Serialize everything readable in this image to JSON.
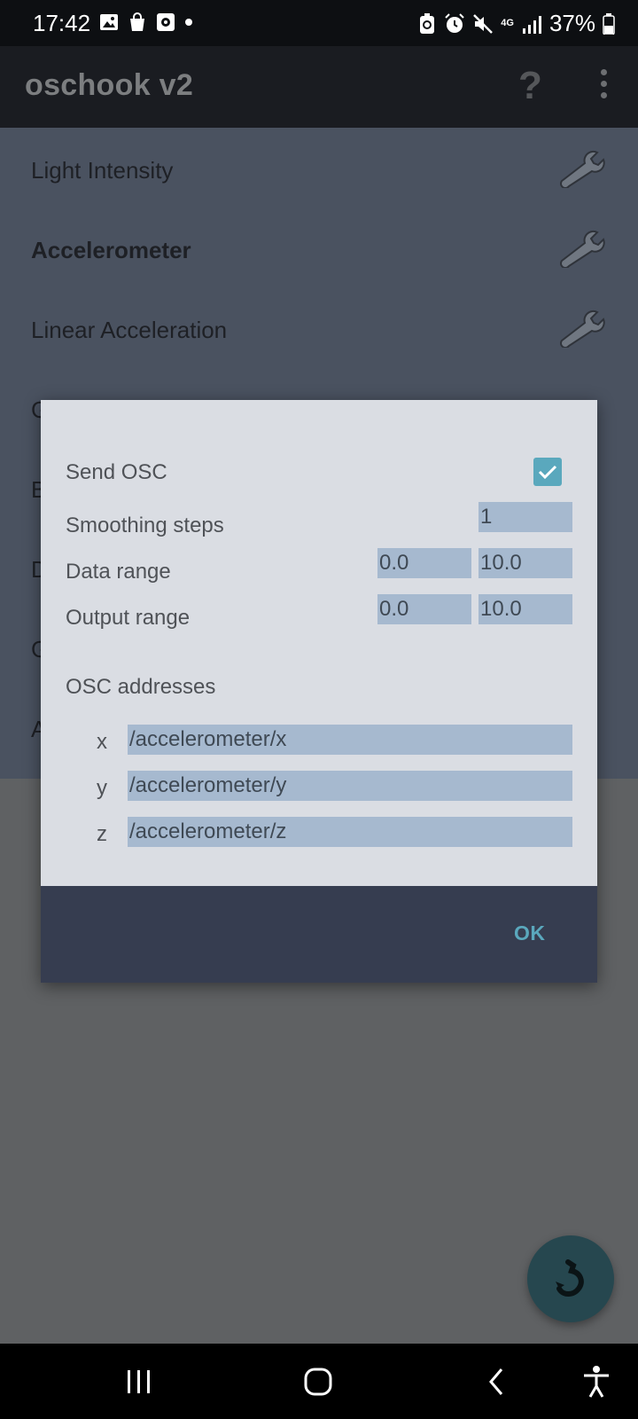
{
  "status_bar": {
    "time": "17:42",
    "battery": "37%",
    "network_label": "4G"
  },
  "app_bar": {
    "title": "oschook v2",
    "help": "?"
  },
  "sensor_list": [
    {
      "label": "Light Intensity",
      "bold": false
    },
    {
      "label": "Accelerometer",
      "bold": true
    },
    {
      "label": "Linear Acceleration",
      "bold": false
    },
    {
      "label": "G",
      "bold": false
    },
    {
      "label": "B",
      "bold": false
    },
    {
      "label": "D",
      "bold": false
    },
    {
      "label": "G",
      "bold": false
    },
    {
      "label": "A",
      "bold": false
    }
  ],
  "dialog": {
    "send_osc_label": "Send OSC",
    "send_osc_checked": true,
    "smoothing_label": "Smoothing steps",
    "smoothing_value": "1",
    "data_range_label": "Data range",
    "data_range_min": "0.0",
    "data_range_max": "10.0",
    "output_range_label": "Output range",
    "output_range_min": "0.0",
    "output_range_max": "10.0",
    "osc_addresses_label": "OSC addresses",
    "addresses": [
      {
        "axis": "x",
        "value": "/accelerometer/x"
      },
      {
        "axis": "y",
        "value": "/accelerometer/y"
      },
      {
        "axis": "z",
        "value": "/accelerometer/z"
      }
    ],
    "ok_label": "OK"
  },
  "colors": {
    "accent": "#5aa8bd",
    "field_bg": "#a6b9cf",
    "dialog_bg": "#dadde3",
    "dialog_footer": "#363d50"
  }
}
